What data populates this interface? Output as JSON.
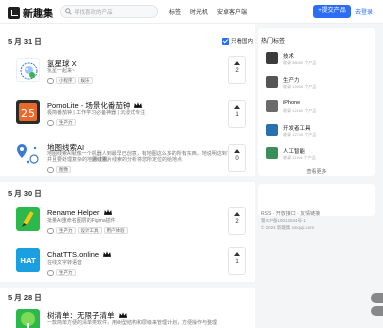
{
  "header": {
    "logo_text": "新趣集",
    "search_placeholder": "寻找喜欢的产品",
    "nav": [
      "标签",
      "时光机",
      "安卓客户端"
    ],
    "submit_label": "+提交产品",
    "login_label": "去登录"
  },
  "feed": {
    "cn_only_label": "只看国内",
    "days": [
      {
        "date": "5 月 31 日",
        "items": [
          {
            "title": "氢星球 X",
            "desc": "氢星一起来~",
            "tags": [
              "小程序",
              "娱乐"
            ],
            "votes": "2"
          },
          {
            "title": "PomoLite - 场景化番茄钟",
            "desc": "极简番茄钟 | 工作学习必备神器 | 沉浸式专注",
            "tags": [
              "生产力"
            ],
            "votes": "1"
          },
          {
            "title": "地图线索AI",
            "desc": "地图线索AI就像一个机器人到最早已创意，有地图这么多的所有东西，地说明这到了和那，",
            "desc2": "并且要处理复杂的地图线索，",
            "desc3": "通过图片线索的分析将您所定位的给地点",
            "tags": [
              "图像"
            ],
            "votes": "0"
          }
        ]
      },
      {
        "date": "5 月 30 日",
        "items": [
          {
            "title": "Rename Helper",
            "desc": "批量AI重命名图层的Figma插件",
            "tags": [
              "生产力",
              "设计工具",
              "用户体验"
            ],
            "votes": "2"
          },
          {
            "title": "ChatTTS.online",
            "desc": "在线文字转语音",
            "tags": [
              "生产力"
            ],
            "votes": "1"
          }
        ]
      },
      {
        "date": "5 月 28 日",
        "items": [
          {
            "title": "树清单：无限子清单",
            "desc": "一款简单方便的清单类软件，用树型结构和层级来管理计划，方便操作与整理",
            "tags": [],
            "votes": ""
          }
        ]
      }
    ]
  },
  "sidebar": {
    "hot_title": "热门标签",
    "hot_tags": [
      {
        "name": "技术",
        "sub": "收录 38090 个产品"
      },
      {
        "name": "生产力",
        "sub": "收录 19406 个产品"
      },
      {
        "name": "iPhone",
        "sub": "收录 12160 个产品"
      },
      {
        "name": "开发者工具",
        "sub": "收录 12740 个产品"
      },
      {
        "name": "人工智能",
        "sub": "收录 11194 个产品"
      }
    ],
    "more_label": "查看更多",
    "footer_links": "RSS · 开放接口 · 友情链接",
    "icp": "蜀ICP备19012534号-1",
    "copyright": "© 2024 新趣集 xinquji.com"
  },
  "colors": {
    "accent": "#2b6ef5",
    "background": "#f4f5f7",
    "card": "#ffffff"
  }
}
